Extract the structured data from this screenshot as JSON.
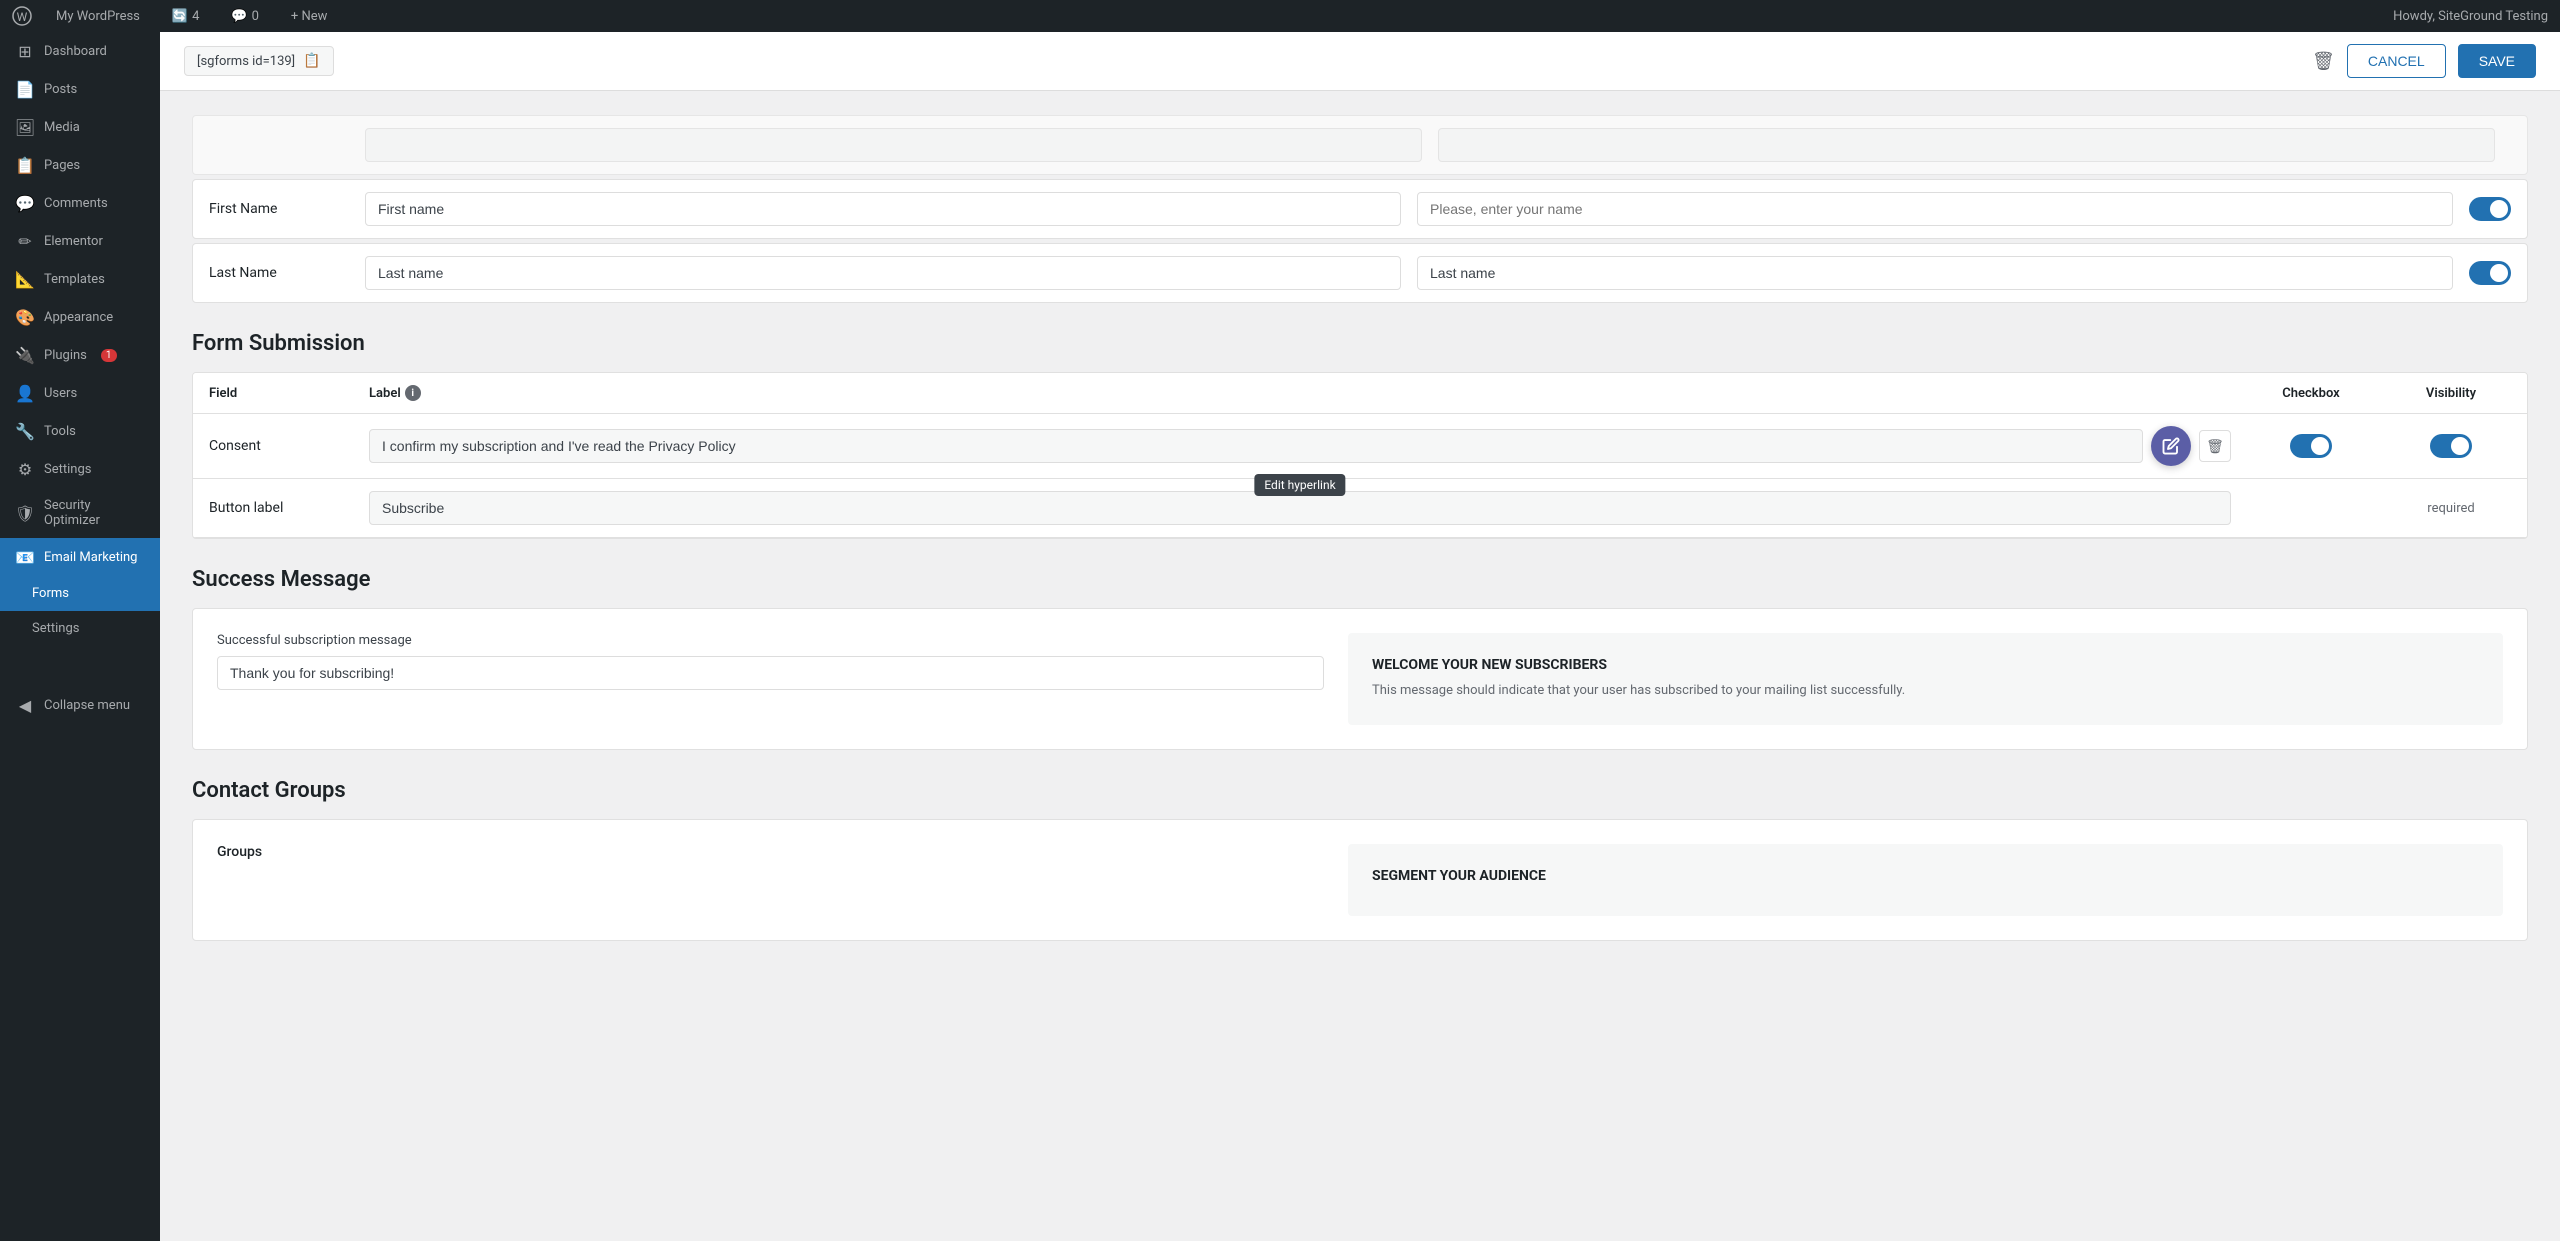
{
  "admin_bar": {
    "logo": "W",
    "site_name": "My WordPress",
    "updates_count": "4",
    "comments_count": "0",
    "new_label": "+ New",
    "howdy": "Howdy, SiteGround Testing"
  },
  "sidebar": {
    "items": [
      {
        "id": "dashboard",
        "icon": "⊞",
        "label": "Dashboard"
      },
      {
        "id": "posts",
        "icon": "📄",
        "label": "Posts"
      },
      {
        "id": "media",
        "icon": "🖼",
        "label": "Media"
      },
      {
        "id": "pages",
        "icon": "📋",
        "label": "Pages"
      },
      {
        "id": "comments",
        "icon": "💬",
        "label": "Comments"
      },
      {
        "id": "elementor",
        "icon": "✏",
        "label": "Elementor"
      },
      {
        "id": "templates",
        "icon": "📐",
        "label": "Templates"
      },
      {
        "id": "appearance",
        "icon": "🎨",
        "label": "Appearance"
      },
      {
        "id": "plugins",
        "icon": "🔌",
        "label": "Plugins",
        "badge": "1"
      },
      {
        "id": "users",
        "icon": "👤",
        "label": "Users"
      },
      {
        "id": "tools",
        "icon": "🔧",
        "label": "Tools"
      },
      {
        "id": "settings",
        "icon": "⚙",
        "label": "Settings"
      },
      {
        "id": "security",
        "icon": "🛡",
        "label": "Security Optimizer"
      },
      {
        "id": "email-marketing",
        "icon": "📧",
        "label": "Email Marketing",
        "active": true
      }
    ],
    "submenu": [
      {
        "id": "forms",
        "label": "Forms",
        "active": true
      },
      {
        "id": "settings",
        "label": "Settings"
      }
    ]
  },
  "topbar": {
    "shortcode": "[sgforms id=139]",
    "cancel_label": "CANCEL",
    "save_label": "SAVE"
  },
  "fields": {
    "top_row": {
      "label": "",
      "value": "",
      "placeholder": ""
    },
    "first_name": {
      "label": "First Name",
      "value": "First name",
      "placeholder": "Please, enter your name",
      "toggle_on": true
    },
    "last_name": {
      "label": "Last Name",
      "value": "Last name",
      "placeholder2": "Last name",
      "toggle_on": true
    }
  },
  "form_submission": {
    "section_title": "Form Submission",
    "table_headers": {
      "field": "Field",
      "label": "Label",
      "checkbox": "Checkbox",
      "visibility": "Visibility"
    },
    "rows": [
      {
        "field": "Consent",
        "label_value": "I confirm my subscription and I've read the Privacy Policy",
        "checkbox_on": true,
        "visibility_on": true,
        "has_edit": true,
        "tooltip": "Edit hyperlink"
      },
      {
        "field": "Button label",
        "label_value": "Subscribe",
        "required": "required",
        "has_edit": false
      }
    ]
  },
  "success_message": {
    "section_title": "Success Message",
    "label": "Successful subscription message",
    "value": "Thank you for subscribing!",
    "right_title": "WELCOME YOUR NEW SUBSCRIBERS",
    "right_desc": "This message should indicate that your user has subscribed to your mailing list successfully."
  },
  "contact_groups": {
    "section_title": "Contact Groups",
    "label": "Groups",
    "right_title": "SEGMENT YOUR AUDIENCE",
    "right_desc": ""
  }
}
